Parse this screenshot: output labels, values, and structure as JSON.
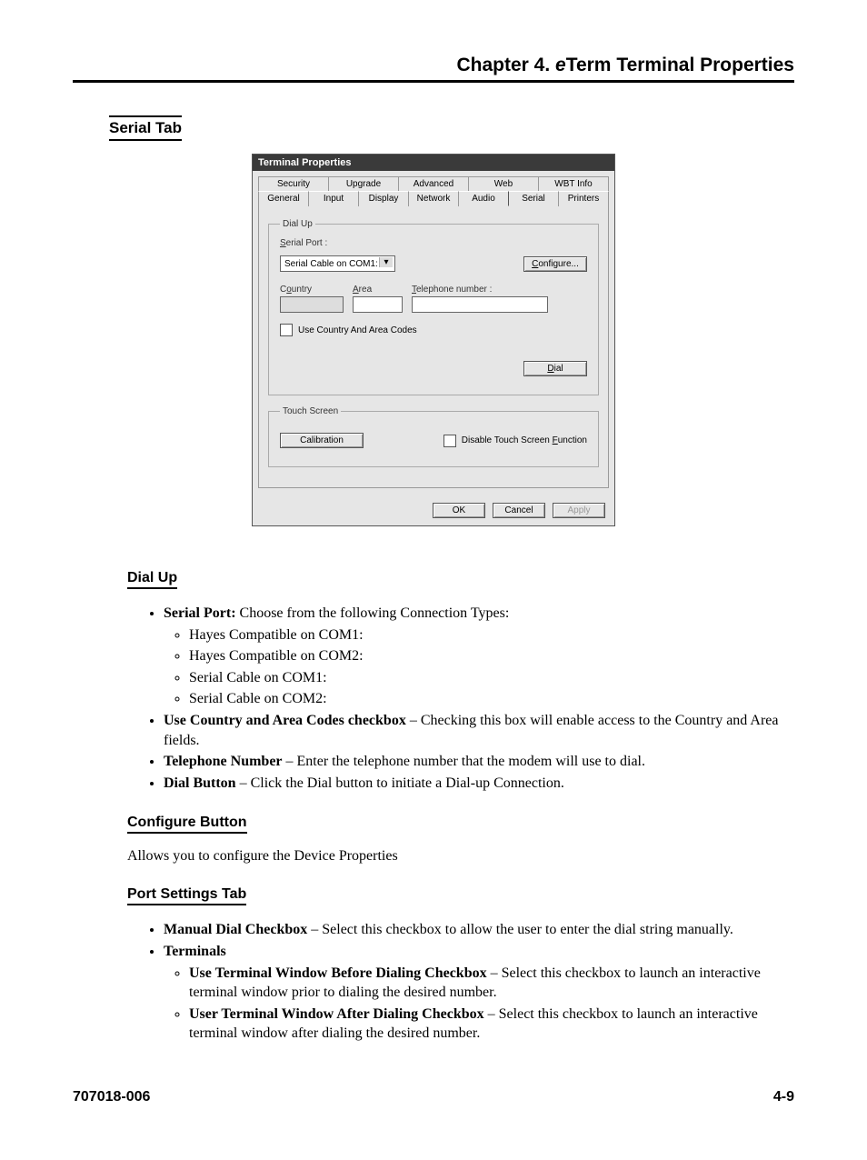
{
  "header": {
    "prefix": "Chapter 4.  ",
    "italic": "e",
    "suffix": "Term Terminal Properties"
  },
  "sections": {
    "serialTab": "Serial Tab",
    "dialUp": "Dial Up",
    "configureButton": "Configure Button",
    "portSettingsTab": "Port Settings Tab"
  },
  "dialUpList": {
    "serialPort_label": "Serial Port:",
    "serialPort_text": " Choose from the following Connection Types:",
    "opts": [
      "Hayes Compatible on COM1:",
      "Hayes Compatible on COM2:",
      "Serial Cable on COM1:",
      "Serial Cable on COM2:"
    ],
    "useCodes_label": "Use Country and Area Codes checkbox",
    "useCodes_text": " – Checking this box will enable access to the Country and Area fields.",
    "tel_label": "Telephone Number",
    "tel_text": " – Enter the telephone number that the modem will use to dial.",
    "dial_label": "Dial Button",
    "dial_text": " – Click the Dial button to initiate a Dial-up Connection."
  },
  "configureText": "Allows you to configure the Device Properties",
  "portSettings": {
    "manual_label": "Manual Dial Checkbox",
    "manual_text": " – Select this checkbox to allow the user to enter the dial string manually.",
    "terminals_label": "Terminals",
    "before_label": "Use Terminal Window Before Dialing Checkbox",
    "before_text": " – Select this checkbox to launch an interactive terminal window prior to dialing the desired number.",
    "after_label": "User Terminal Window After Dialing Checkbox",
    "after_text": " – Select this checkbox to launch an interactive terminal window after dialing the desired number."
  },
  "footer": {
    "left": "707018-006",
    "right": "4-9"
  },
  "dialog": {
    "title": "Terminal Properties",
    "tabs_row1": [
      "Security",
      "Upgrade",
      "Advanced",
      "Web",
      "WBT Info"
    ],
    "tabs_row2": [
      "General",
      "Input",
      "Display",
      "Network",
      "Audio",
      "Serial",
      "Printers"
    ],
    "selected_tab": "Serial",
    "group_dialup": "Dial Up",
    "group_touch": "Touch Screen",
    "lbl_serialport": "Serial Port :",
    "val_serialport": "Serial Cable on COM1:",
    "btn_configure": "Configure...",
    "lbl_country": "Country",
    "lbl_area": "Area",
    "lbl_tel": "Telephone number :",
    "chk_usecodes": "Use Country And Area Codes",
    "btn_dial": "Dial",
    "btn_calib": "Calibration",
    "chk_disable_touch": "Disable Touch Screen Function",
    "btn_ok": "OK",
    "btn_cancel": "Cancel",
    "btn_apply": "Apply",
    "underline": {
      "configure": "C",
      "dial": "D",
      "disable": "F",
      "serialport": "S",
      "country": "o",
      "area": "A",
      "tel": "T"
    }
  }
}
